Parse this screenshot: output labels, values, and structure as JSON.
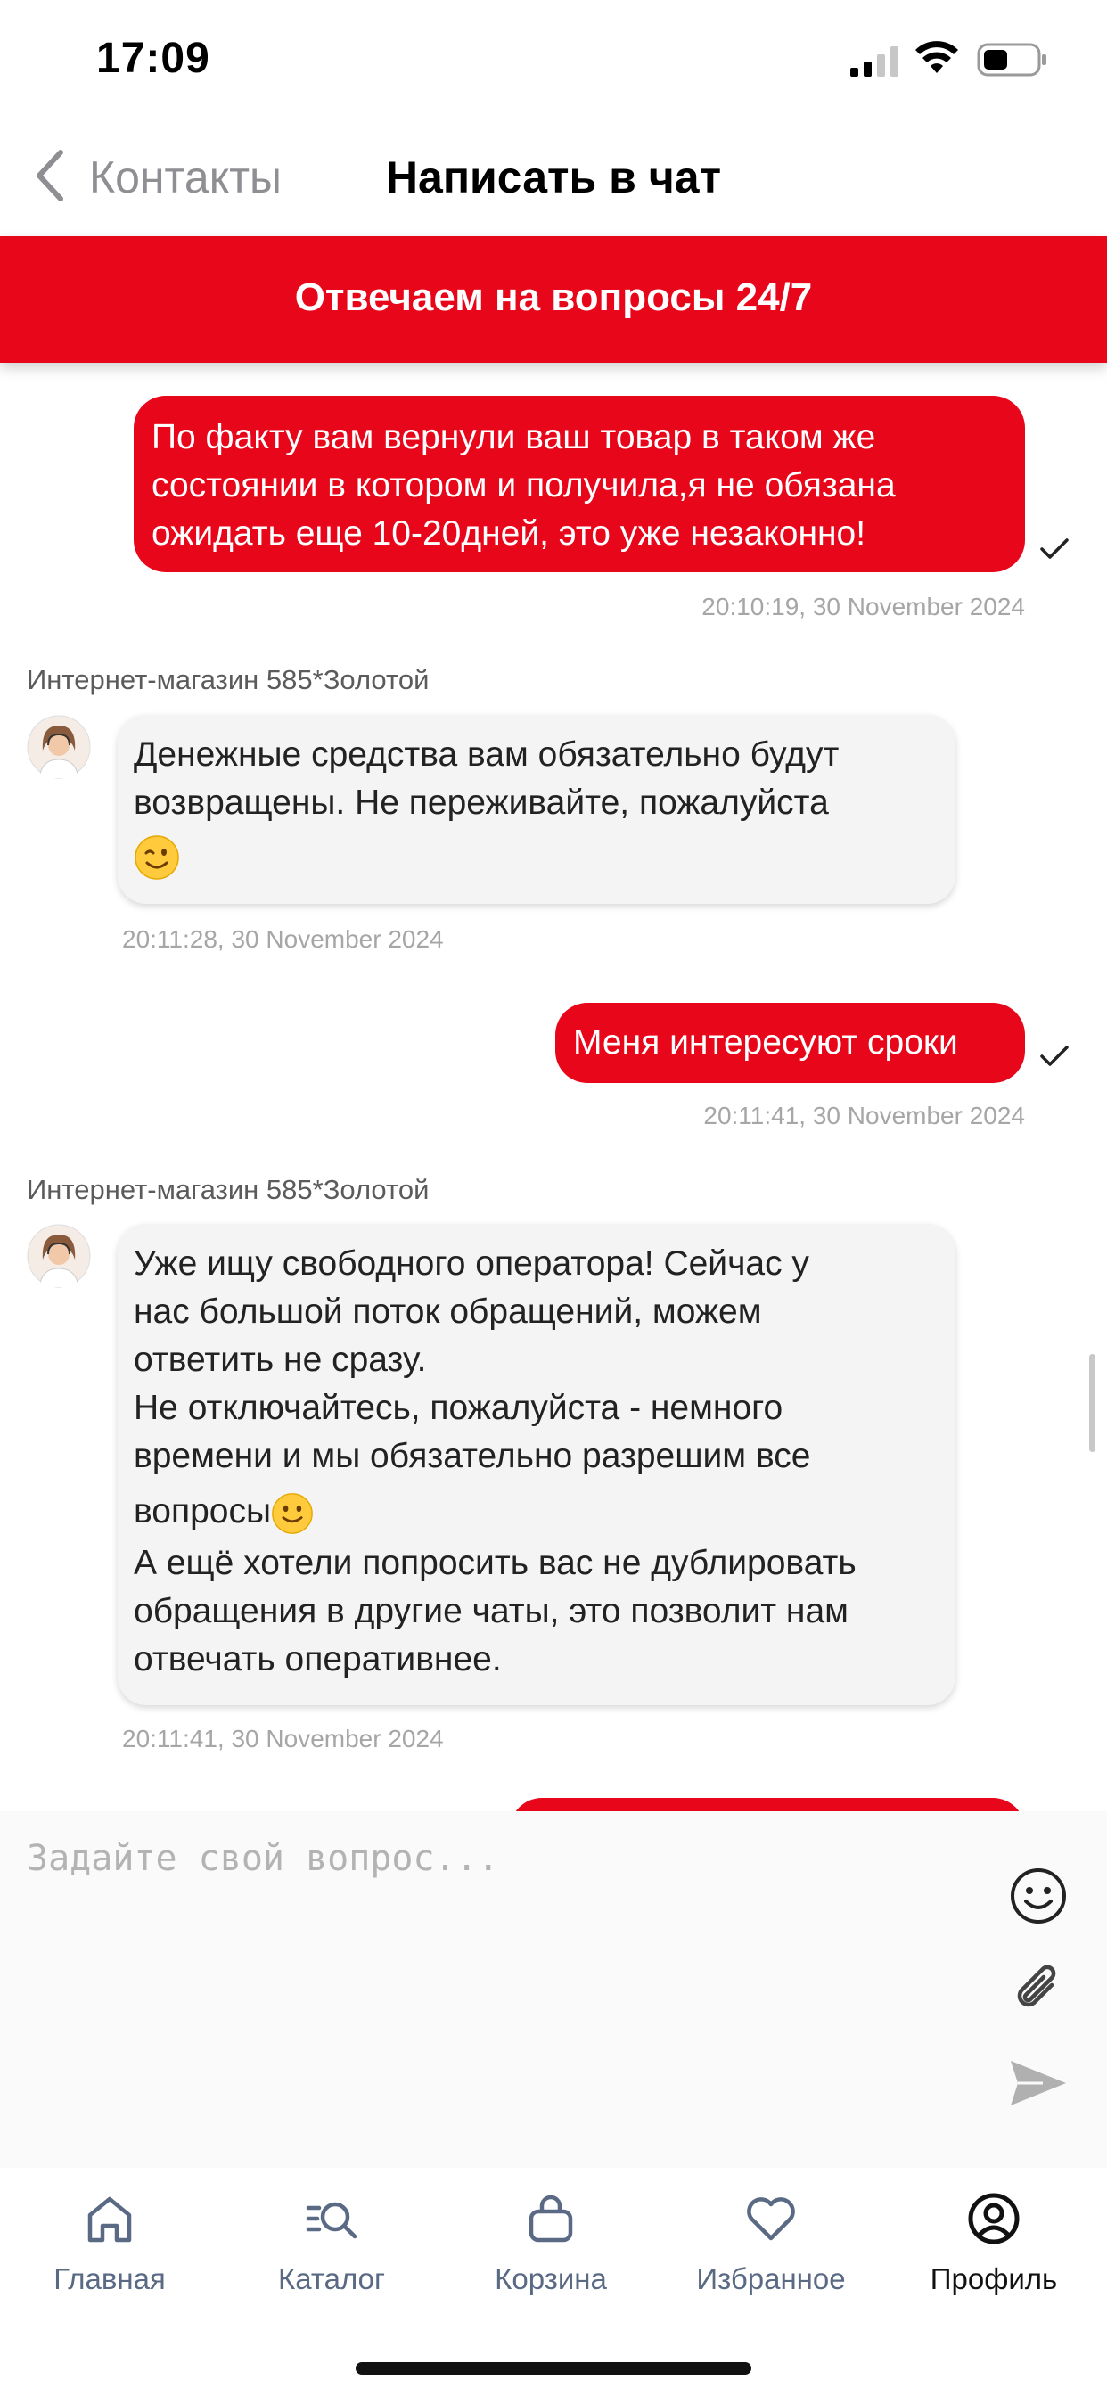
{
  "status_bar": {
    "time": "17:09"
  },
  "nav": {
    "back_label": "Контакты",
    "title": "Написать в чат"
  },
  "banner": {
    "text": "Отвечаем на вопросы 24/7"
  },
  "messages": {
    "m1": {
      "lines": [
        "По факту вам вернули ваш товар в таком же",
        "состоянии в котором и получила,я не обязана",
        "ожидать еще 10-20дней, это уже незаконно!"
      ],
      "timestamp": "20:10:19, 30 November 2024"
    },
    "m2": {
      "sender": "Интернет-магазин 585*Золотой",
      "lines": [
        "Денежные средства вам обязательно будут",
        "возвращены. Не переживайте, пожалуйста"
      ],
      "emoji": "winking-face",
      "timestamp": "20:11:28, 30 November 2024"
    },
    "m3": {
      "text": "Меня интересуют сроки",
      "timestamp": "20:11:41, 30 November 2024"
    },
    "m4": {
      "sender": "Интернет-магазин 585*Золотой",
      "lines": [
        "Уже ищу свободного оператора! Сейчас у",
        "нас большой поток обращений, можем",
        "ответить не сразу.",
        "Не отключайтесь, пожалуйста - немного",
        "времени и мы обязательно разрешим все",
        "вопросы",
        "А ещё хотели попросить вас не дублировать",
        "обращения в другие чаты, это позволит нам",
        "отвечать оперативнее."
      ],
      "emoji": "smiling-face",
      "timestamp": "20:11:41, 30 November 2024"
    }
  },
  "composer": {
    "placeholder": "Задайте свой вопрос...",
    "icons": [
      "emoji-icon",
      "attach-icon",
      "send-icon"
    ]
  },
  "tabbar": {
    "items": [
      {
        "label": "Главная",
        "icon": "home-icon"
      },
      {
        "label": "Каталог",
        "icon": "catalog-search-icon"
      },
      {
        "label": "Корзина",
        "icon": "bag-icon"
      },
      {
        "label": "Избранное",
        "icon": "heart-icon"
      },
      {
        "label": "Профиль",
        "icon": "profile-icon"
      }
    ],
    "active": "Профиль"
  },
  "colors": {
    "accent": "#e8071a",
    "incoming_bubble": "#f4f4f4",
    "timestamp": "#a6a6a6",
    "tab_inactive": "#5a6a84"
  }
}
